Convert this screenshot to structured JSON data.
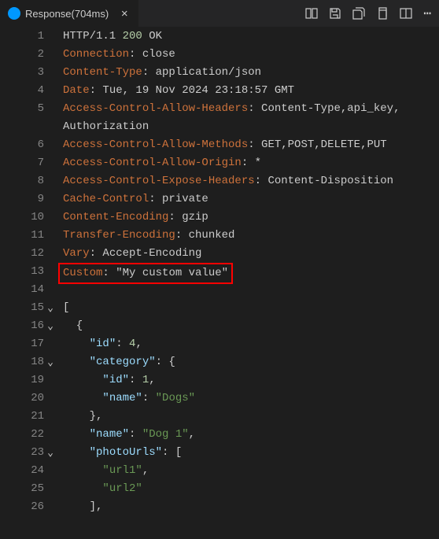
{
  "tab": {
    "icon_text": "",
    "title": "Response(704ms)",
    "close": "×"
  },
  "actions": {
    "diff": "diff-icon",
    "save": "save-icon",
    "saveall": "saveall-icon",
    "copy": "copy-icon",
    "split": "split-icon",
    "more": "⋯"
  },
  "code": {
    "l1_a": "HTTP/1.1 ",
    "l1_b": "200",
    "l1_c": " OK",
    "l2_a": "Connection",
    "l2_b": ": close",
    "l3_a": "Content-Type",
    "l3_b": ": application/json",
    "l4_a": "Date",
    "l4_b": ": Tue, 19 Nov 2024 23:18:57 GMT",
    "l5_a": "Access-Control-Allow-Headers",
    "l5_b": ": Content-Type,api_key,",
    "l5w": "Authorization",
    "l6_a": "Access-Control-Allow-Methods",
    "l6_b": ": GET,POST,DELETE,PUT",
    "l7_a": "Access-Control-Allow-Origin",
    "l7_b": ": *",
    "l8_a": "Access-Control-Expose-Headers",
    "l8_b": ": Content-Disposition",
    "l9_a": "Cache-Control",
    "l9_b": ": private",
    "l10_a": "Content-Encoding",
    "l10_b": ": gzip",
    "l11_a": "Transfer-Encoding",
    "l11_b": ": chunked",
    "l12_a": "Vary",
    "l12_b": ": Accept-Encoding",
    "l13_a": "Custom",
    "l13_b": ": ",
    "l13_c": "\"My custom value\"",
    "l14": "",
    "l15": "[",
    "l16": "  {",
    "l17_a": "    ",
    "l17_b": "\"id\"",
    "l17_c": ": ",
    "l17_d": "4",
    "l17_e": ",",
    "l18_a": "    ",
    "l18_b": "\"category\"",
    "l18_c": ": {",
    "l19_a": "      ",
    "l19_b": "\"id\"",
    "l19_c": ": ",
    "l19_d": "1",
    "l19_e": ",",
    "l20_a": "      ",
    "l20_b": "\"name\"",
    "l20_c": ": ",
    "l20_d": "\"Dogs\"",
    "l21": "    },",
    "l22_a": "    ",
    "l22_b": "\"name\"",
    "l22_c": ": ",
    "l22_d": "\"Dog 1\"",
    "l22_e": ",",
    "l23_a": "    ",
    "l23_b": "\"photoUrls\"",
    "l23_c": ": [",
    "l24_a": "      ",
    "l24_b": "\"url1\"",
    "l24_c": ",",
    "l25_a": "      ",
    "l25_b": "\"url2\"",
    "l26": "    ],"
  },
  "lines": [
    "1",
    "2",
    "3",
    "4",
    "5",
    "6",
    "7",
    "8",
    "9",
    "10",
    "11",
    "12",
    "13",
    "14",
    "15",
    "16",
    "17",
    "18",
    "19",
    "20",
    "21",
    "22",
    "23",
    "24",
    "25",
    "26"
  ],
  "fold_open": "⌄"
}
